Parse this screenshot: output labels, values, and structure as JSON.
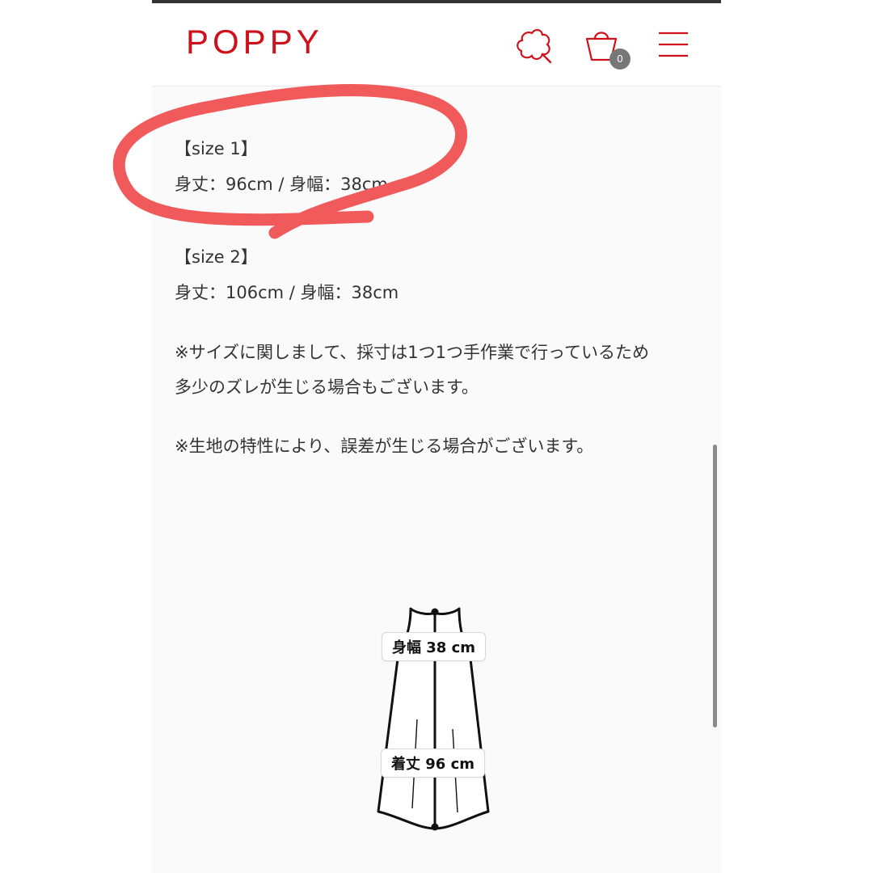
{
  "header": {
    "logo": "POPPY",
    "cart_count": "0",
    "icons": [
      "flower-search-icon",
      "cart-icon",
      "menu-icon"
    ],
    "brand_color": "#d0111b"
  },
  "content": {
    "size1": {
      "heading": "【size 1】",
      "dims": "身丈：96cm / 身幅：38cm"
    },
    "size2": {
      "heading": "【size 2】",
      "dims": "身丈：106cm / 身幅：38cm"
    },
    "note1": {
      "line1": "※サイズに関しまして、採寸は1つ1つ手作業で行っているため",
      "line2": "多少のズレが生じる場合もございます。"
    },
    "note2": "※生地の特性により、誤差が生じる場合がございます。"
  },
  "diagram": {
    "width_label": "身幅 38 cm",
    "length_label": "着丈 96 cm"
  },
  "annotation": {
    "color": "#f05a5a",
    "shape": "hand-drawn circle"
  }
}
